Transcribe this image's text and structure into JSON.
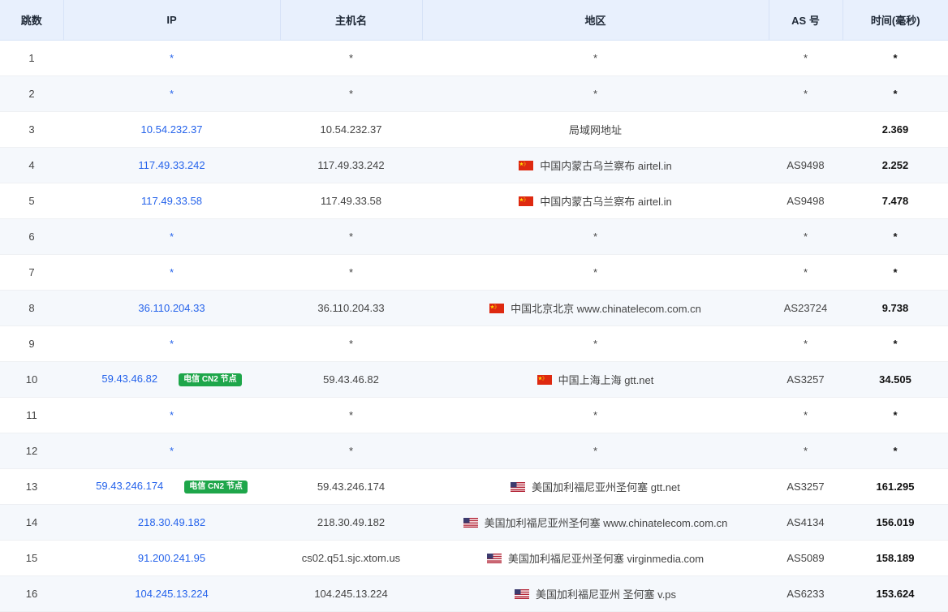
{
  "columns": [
    "跳数",
    "IP",
    "主机名",
    "地区",
    "AS 号",
    "时间(毫秒)"
  ],
  "badge_text": "电信 CN2 节点",
  "rows": [
    {
      "hop": "1",
      "ip": "*",
      "host": "*",
      "region": "*",
      "flag": "",
      "as": "*",
      "time": "*",
      "cn2": false
    },
    {
      "hop": "2",
      "ip": "*",
      "host": "*",
      "region": "*",
      "flag": "",
      "as": "*",
      "time": "*",
      "cn2": false
    },
    {
      "hop": "3",
      "ip": "10.54.232.37",
      "host": "10.54.232.37",
      "region": "局域网地址",
      "flag": "",
      "as": "",
      "time": "2.369",
      "cn2": false
    },
    {
      "hop": "4",
      "ip": "117.49.33.242",
      "host": "117.49.33.242",
      "region": "中国内蒙古乌兰察布 airtel.in",
      "flag": "cn",
      "as": "AS9498",
      "time": "2.252",
      "cn2": false
    },
    {
      "hop": "5",
      "ip": "117.49.33.58",
      "host": "117.49.33.58",
      "region": "中国内蒙古乌兰察布 airtel.in",
      "flag": "cn",
      "as": "AS9498",
      "time": "7.478",
      "cn2": false
    },
    {
      "hop": "6",
      "ip": "*",
      "host": "*",
      "region": "*",
      "flag": "",
      "as": "*",
      "time": "*",
      "cn2": false
    },
    {
      "hop": "7",
      "ip": "*",
      "host": "*",
      "region": "*",
      "flag": "",
      "as": "*",
      "time": "*",
      "cn2": false
    },
    {
      "hop": "8",
      "ip": "36.110.204.33",
      "host": "36.110.204.33",
      "region": "中国北京北京 www.chinatelecom.com.cn",
      "flag": "cn",
      "as": "AS23724",
      "time": "9.738",
      "cn2": false
    },
    {
      "hop": "9",
      "ip": "*",
      "host": "*",
      "region": "*",
      "flag": "",
      "as": "*",
      "time": "*",
      "cn2": false
    },
    {
      "hop": "10",
      "ip": "59.43.46.82",
      "host": "59.43.46.82",
      "region": "中国上海上海 gtt.net",
      "flag": "cn",
      "as": "AS3257",
      "time": "34.505",
      "cn2": true
    },
    {
      "hop": "11",
      "ip": "*",
      "host": "*",
      "region": "*",
      "flag": "",
      "as": "*",
      "time": "*",
      "cn2": false
    },
    {
      "hop": "12",
      "ip": "*",
      "host": "*",
      "region": "*",
      "flag": "",
      "as": "*",
      "time": "*",
      "cn2": false
    },
    {
      "hop": "13",
      "ip": "59.43.246.174",
      "host": "59.43.246.174",
      "region": "美国加利福尼亚州圣何塞 gtt.net",
      "flag": "us",
      "as": "AS3257",
      "time": "161.295",
      "cn2": true
    },
    {
      "hop": "14",
      "ip": "218.30.49.182",
      "host": "218.30.49.182",
      "region": "美国加利福尼亚州圣何塞 www.chinatelecom.com.cn",
      "flag": "us",
      "as": "AS4134",
      "time": "156.019",
      "cn2": false
    },
    {
      "hop": "15",
      "ip": "91.200.241.95",
      "host": "cs02.q51.sjc.xtom.us",
      "region": "美国加利福尼亚州圣何塞 virginmedia.com",
      "flag": "us",
      "as": "AS5089",
      "time": "158.189",
      "cn2": false
    },
    {
      "hop": "16",
      "ip": "104.245.13.224",
      "host": "104.245.13.224",
      "region": "美国加利福尼亚州 圣何塞 v.ps",
      "flag": "us",
      "as": "AS6233",
      "time": "153.624",
      "cn2": false
    }
  ]
}
